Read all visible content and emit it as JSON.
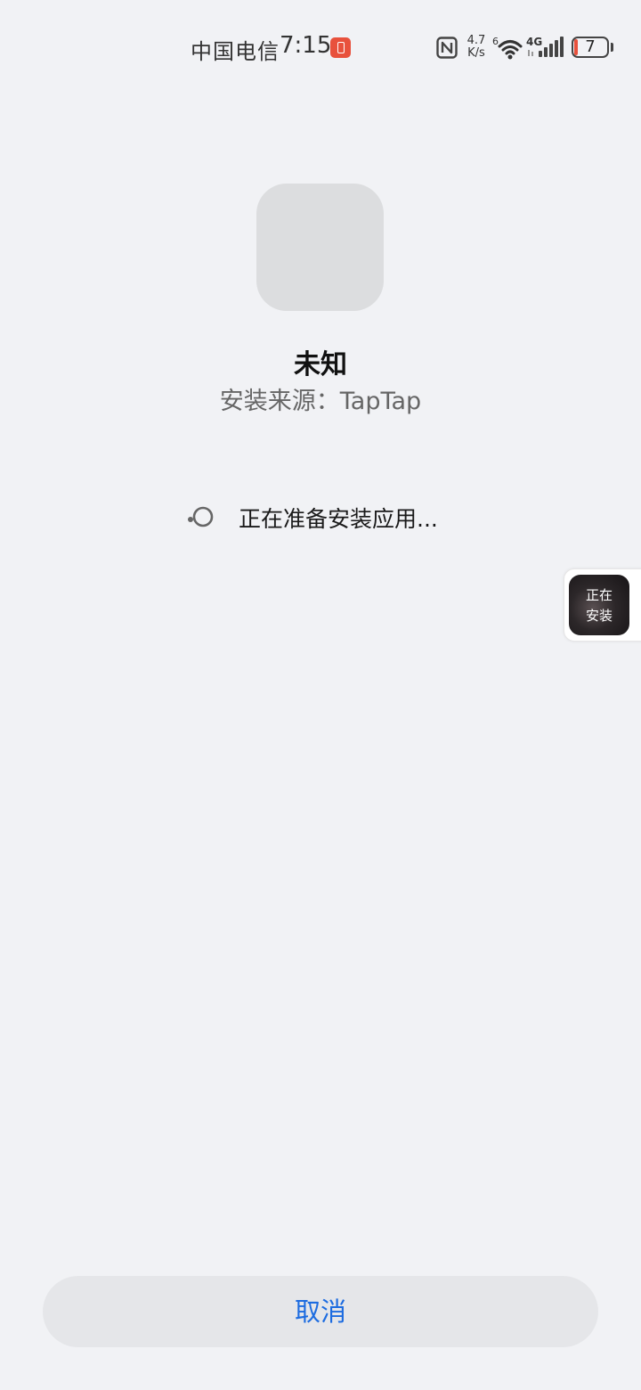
{
  "status_bar": {
    "carrier": "中国电信",
    "time": "7:15",
    "power_save_icon": "battery-saver-icon",
    "nfc_icon": "nfc-icon",
    "net_speed_value": "4.7",
    "net_speed_unit": "K/s",
    "wifi_icon": "wifi-icon",
    "wifi_label": "6",
    "signal_icon": "cellular-signal-icon",
    "network_type": "4G",
    "battery_level": "7",
    "battery_color": "#e8513c"
  },
  "app": {
    "name": "未知",
    "install_source": "安装来源：TapTap"
  },
  "progress": {
    "icon": "loading-spinner-icon",
    "text": "正在准备安装应用..."
  },
  "floating_bubble": {
    "line1": "正在",
    "line2": "安装"
  },
  "actions": {
    "cancel_label": "取消",
    "accent_color": "#1d6ce0"
  }
}
